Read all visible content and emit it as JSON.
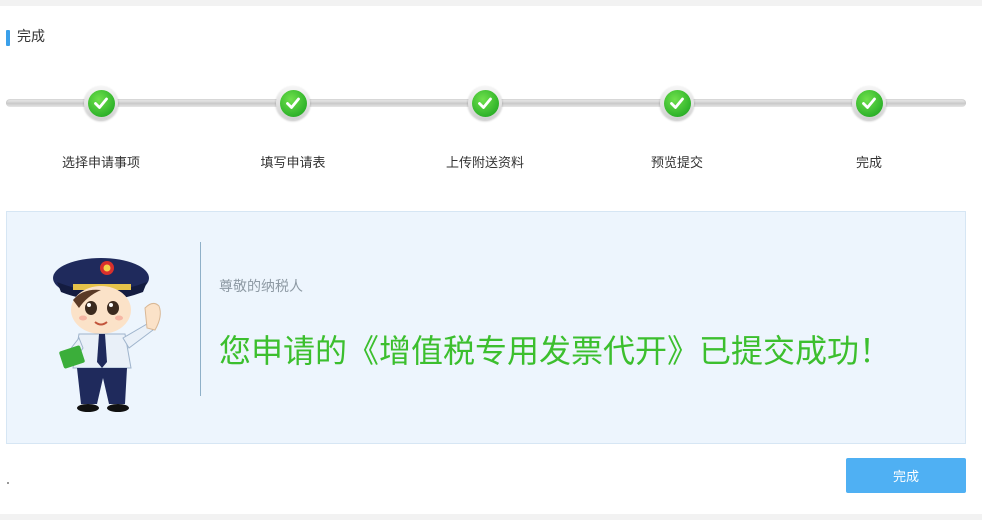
{
  "section": {
    "title": "完成"
  },
  "steps": [
    {
      "label": "选择申请事项",
      "status": "completed",
      "icon": "check-icon"
    },
    {
      "label": "填写申请表",
      "status": "completed",
      "icon": "check-icon"
    },
    {
      "label": "上传附送资料",
      "status": "completed",
      "icon": "check-icon"
    },
    {
      "label": "预览提交",
      "status": "completed",
      "icon": "check-icon"
    },
    {
      "label": "完成",
      "status": "completed",
      "icon": "check-icon"
    }
  ],
  "message": {
    "greeting": "尊敬的纳税人",
    "text": "您申请的《增值税专用发票代开》已提交成功！"
  },
  "actions": {
    "finish_label": "完成"
  },
  "colors": {
    "accent": "#3aa0ea",
    "success": "#3cbf2e",
    "button": "#4fb0f3",
    "panel": "#edf5fd"
  }
}
